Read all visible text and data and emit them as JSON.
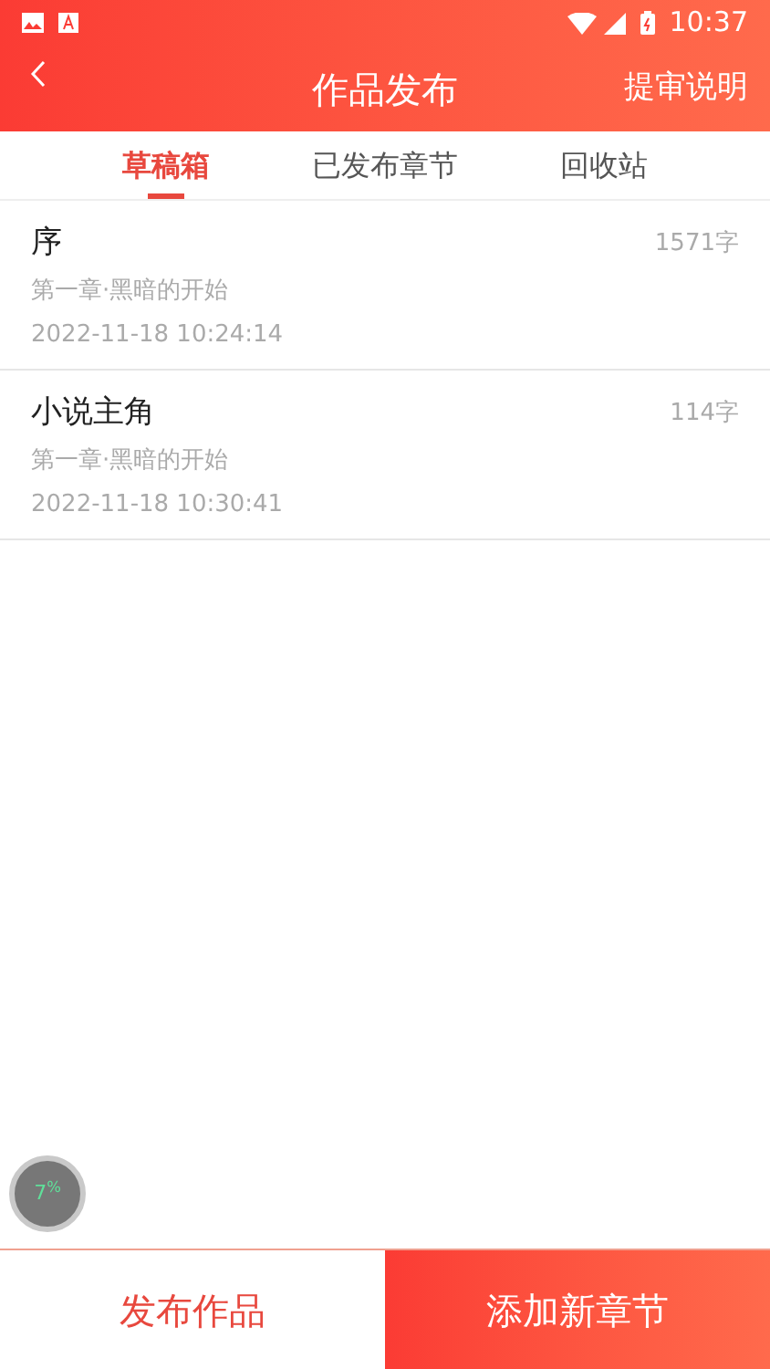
{
  "status_bar": {
    "time": "10:37"
  },
  "header": {
    "title": "作品发布",
    "action": "提审说明"
  },
  "tabs": [
    {
      "label": "草稿箱",
      "selected": true
    },
    {
      "label": "已发布章节",
      "selected": false
    },
    {
      "label": "回收站",
      "selected": false
    }
  ],
  "drafts": [
    {
      "title": "序",
      "chapter": "第一章·黑暗的开始",
      "date": "2022-11-18 10:24:14",
      "words": "1571字"
    },
    {
      "title": "小说主角",
      "chapter": "第一章·黑暗的开始",
      "date": "2022-11-18 10:30:41",
      "words": "114字"
    }
  ],
  "floating_badge": {
    "text": "7$^{%}$"
  },
  "bottom_buttons": [
    "发布作品",
    "添加新章节"
  ]
}
